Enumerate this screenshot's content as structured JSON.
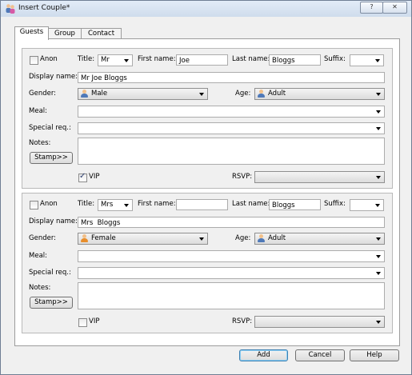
{
  "window": {
    "title": "Insert Couple*",
    "help_glyph": "?",
    "close_glyph": "✕"
  },
  "tabs": [
    {
      "label": "Guests",
      "active": true
    },
    {
      "label": "Group",
      "active": false
    },
    {
      "label": "Contact",
      "active": false
    }
  ],
  "labels": {
    "anon": "Anon",
    "title": "Title:",
    "first_name": "First name:",
    "last_name": "Last name:",
    "suffix": "Suffix:",
    "display_name": "Display name:",
    "gender": "Gender:",
    "age": "Age:",
    "meal": "Meal:",
    "special_req": "Special req.:",
    "notes": "Notes:",
    "stamp": "Stamp>>",
    "vip": "VIP",
    "rsvp": "RSVP:"
  },
  "guests": [
    {
      "anon": false,
      "title": "Mr",
      "first_name": "Joe",
      "last_name": "Bloggs",
      "suffix": "",
      "display_name": "Mr Joe Bloggs",
      "gender": "Male",
      "age": "Adult",
      "meal": "",
      "special_req": "",
      "notes": "",
      "vip": true,
      "rsvp": ""
    },
    {
      "anon": false,
      "title": "Mrs",
      "first_name": "",
      "last_name": "Bloggs",
      "suffix": "",
      "display_name": "Mrs  Bloggs",
      "gender": "Female",
      "age": "Adult",
      "meal": "",
      "special_req": "",
      "notes": "",
      "vip": false,
      "rsvp": ""
    }
  ],
  "buttons": {
    "add": "Add",
    "cancel": "Cancel",
    "help": "Help"
  },
  "colors": {
    "accent_border": "#3c7fb1",
    "male_icon": "#4f79b8",
    "female_icon": "#e88e2c"
  }
}
